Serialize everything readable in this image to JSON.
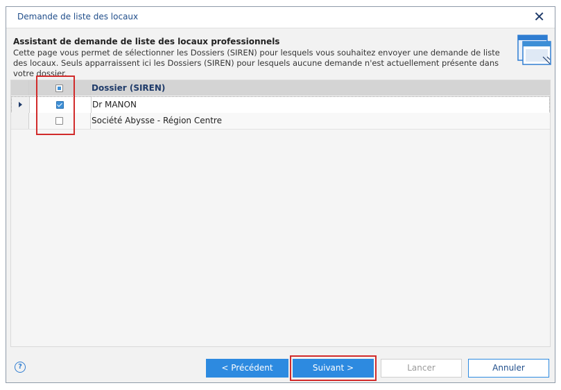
{
  "dialog": {
    "title": "Demande de liste des locaux",
    "close_symbol": "✕"
  },
  "header": {
    "title": "Assistant de demande de liste des locaux professionnels",
    "description": "Cette page vous permet de sélectionner les Dossiers (SIREN)  pour lesquels vous souhaitez envoyer une demande de liste des locaux. Seuls apparraissent ici les Dossiers (SIREN) pour lesquels aucune demande n'est actuellement présente dans votre dossier.",
    "icon": "wizard-window-icon"
  },
  "grid": {
    "column_header": "Dossier (SIREN)",
    "header_checkbox_state": "partial",
    "rows": [
      {
        "label": "Dr MANON",
        "checked": true,
        "current": true
      },
      {
        "label": "Société Abysse - Région Centre",
        "checked": false,
        "current": false
      }
    ]
  },
  "footer": {
    "help_symbol": "?",
    "prev_label": "< Précédent",
    "next_label": "Suivant >",
    "cancel_label": "Lancer",
    "quit_label": "Annuler"
  },
  "colors": {
    "accent": "#2d8ae0",
    "highlight": "#d12a2a",
    "header_bg": "#d4d4d4"
  }
}
